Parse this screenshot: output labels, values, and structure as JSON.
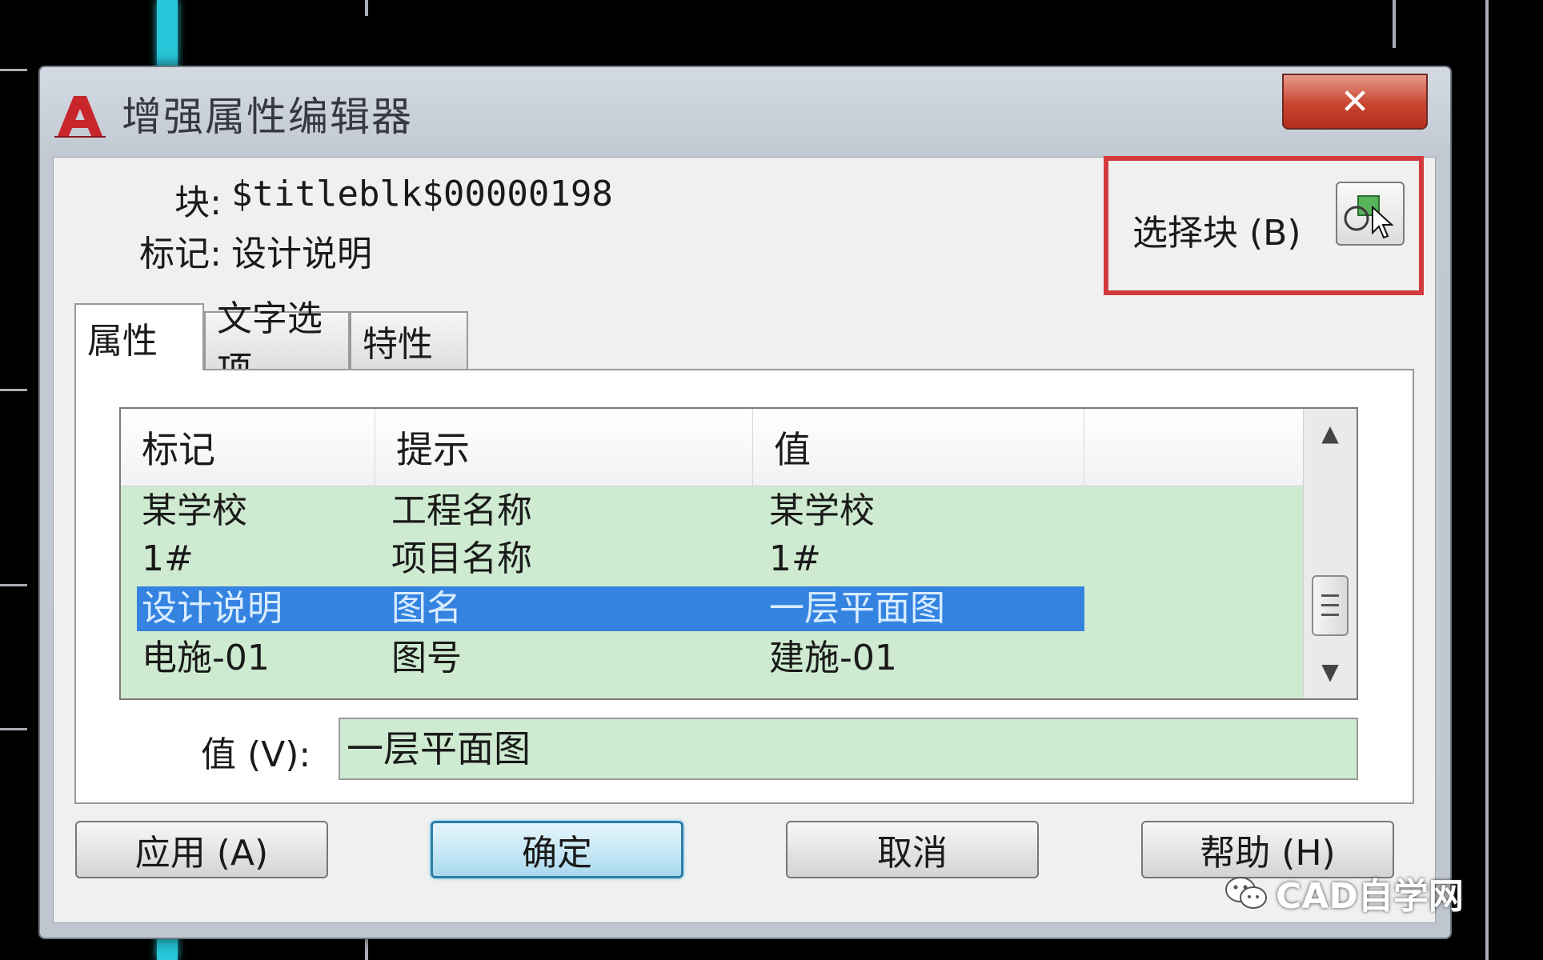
{
  "window": {
    "title": "增强属性编辑器",
    "close_label": "✕"
  },
  "block_info": {
    "block_label": "块:",
    "block_value": "$titleblk$00000198",
    "tag_label": "标记:",
    "tag_value": "设计说明",
    "select_block_label": "选择块 (B)"
  },
  "tabs": [
    {
      "label": "属性",
      "active": true
    },
    {
      "label": "文字选项",
      "active": false
    },
    {
      "label": "特性",
      "active": false
    }
  ],
  "attribute_table": {
    "columns": [
      "标记",
      "提示",
      "值"
    ],
    "rows": [
      {
        "tag": "某学校",
        "prompt": "工程名称",
        "value": "某学校",
        "selected": false
      },
      {
        "tag": "1#",
        "prompt": "项目名称",
        "value": "1#",
        "selected": false
      },
      {
        "tag": "设计说明",
        "prompt": "图名",
        "value": "一层平面图",
        "selected": true
      },
      {
        "tag": "电施-01",
        "prompt": "图号",
        "value": "建施-01",
        "selected": false
      }
    ]
  },
  "value_field": {
    "label": "值 (V):",
    "value": "一层平面图"
  },
  "buttons": {
    "apply": "应用 (A)",
    "ok": "确定",
    "cancel": "取消",
    "help": "帮助 (H)"
  },
  "watermark": {
    "text": "CAD自学网"
  },
  "colors": {
    "list_background": "#ceead0",
    "selection": "#3483e1",
    "highlight_box": "#d23a3c",
    "app_icon": "#c8262b"
  },
  "icons": {
    "app": "autocad-logo-icon",
    "select_block": "select-object-icon",
    "scroll_up": "triangle-up-icon",
    "scroll_down": "triangle-down-icon"
  }
}
